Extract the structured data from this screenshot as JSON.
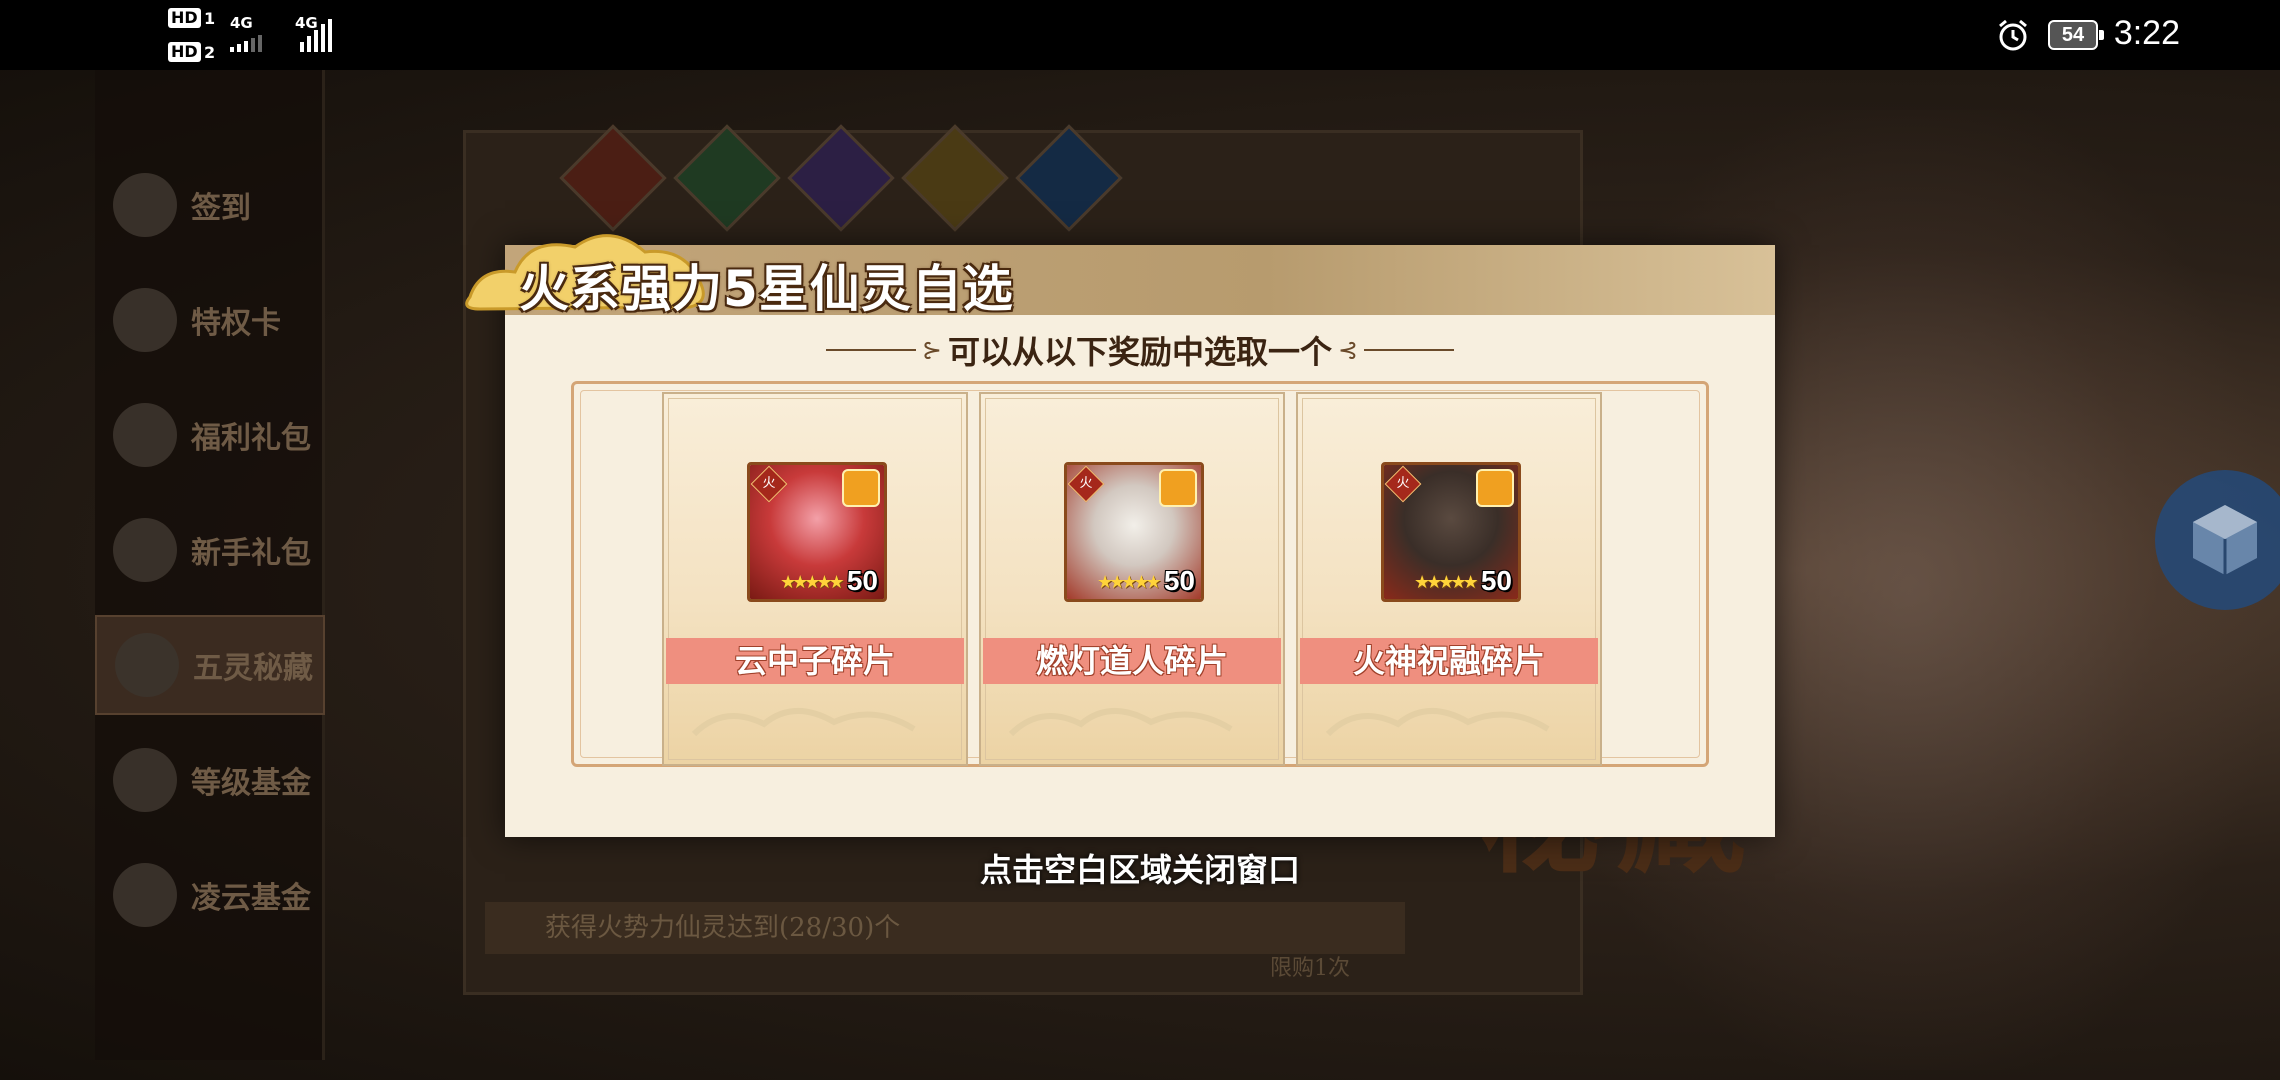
{
  "status_bar": {
    "sim1_label": "HD",
    "sim1_num": "1",
    "sim2_label": "HD",
    "sim2_num": "2",
    "network1": "4G",
    "network2": "4G",
    "battery": "54",
    "time": "3:22"
  },
  "sidebar": {
    "items": [
      {
        "label": "签到",
        "icon": "sign-in-icon"
      },
      {
        "label": "特权卡",
        "icon": "privilege-card-icon"
      },
      {
        "label": "福利礼包",
        "icon": "gift-bag-icon"
      },
      {
        "label": "新手礼包",
        "icon": "gift-bag-icon"
      },
      {
        "label": "五灵秘藏",
        "icon": "gift-bag-icon",
        "active": true
      },
      {
        "label": "等级基金",
        "icon": "coins-icon"
      },
      {
        "label": "凌云基金",
        "icon": "coins-icon"
      }
    ]
  },
  "background": {
    "title": "秘藏",
    "progress_text": "获得火势力仙灵达到(28/30)个",
    "limit_text": "限购1次"
  },
  "modal": {
    "title": "火系强力5星仙灵自选",
    "subtitle": "可以从以下奖励中选取一个",
    "rewards": [
      {
        "name": "云中子碎片",
        "count": "50",
        "element": "火",
        "stars": "★★★★★",
        "accent": "#e8657a"
      },
      {
        "name": "燃灯道人碎片",
        "count": "50",
        "element": "火",
        "stars": "★★★★★",
        "accent": "#d9d2cc"
      },
      {
        "name": "火神祝融碎片",
        "count": "50",
        "element": "火",
        "stars": "★★★★★",
        "accent": "#4a3c34"
      }
    ]
  },
  "close_hint": "点击空白区域关闭窗口"
}
